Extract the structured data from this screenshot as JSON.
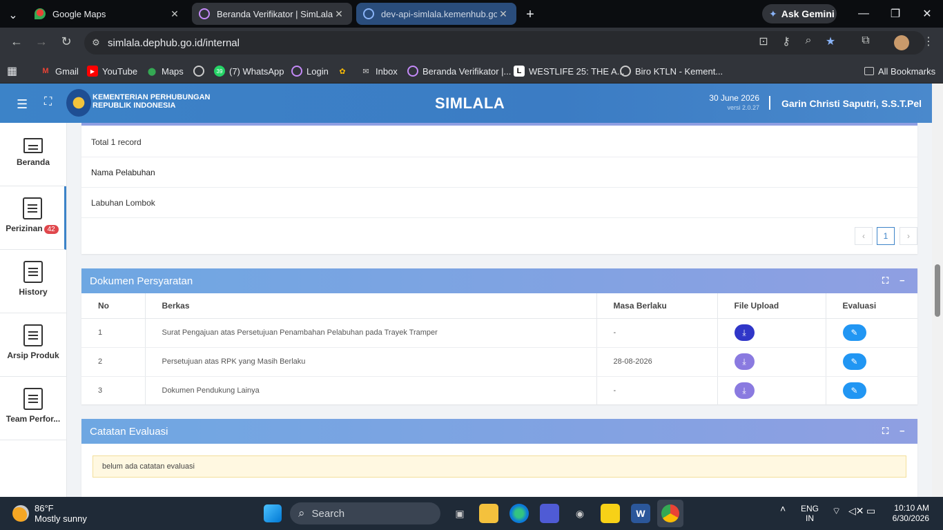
{
  "browser": {
    "tabs": [
      {
        "title": "Google Maps",
        "icon": "google-maps-icon"
      },
      {
        "title": "Beranda Verifikator | SimLala",
        "icon": "simlala-icon",
        "active": true
      },
      {
        "title": "dev-api-simlala.kemenhub.go.id",
        "icon": "globe-icon"
      }
    ],
    "gemini": "Ask Gemini",
    "url": "simlala.dephub.go.id/internal",
    "bookmarks": [
      "Gmail",
      "YouTube",
      "Maps",
      "(7) WhatsApp",
      "Login",
      "Inbox",
      "Beranda Verifikator |...",
      "WESTLIFE 25: THE A...",
      "Biro KTLN - Kement..."
    ],
    "whatsapp_count": "39",
    "all_bookmarks": "All Bookmarks"
  },
  "app": {
    "ministry_line1": "KEMENTERIAN PERHUBUNGAN",
    "ministry_line2": "REPUBLIK INDONESIA",
    "name": "SIMLALA",
    "date": "30 June 2026",
    "version": "versi 2.0.27",
    "user": "Garin Christi Saputri, S.S.T.Pel"
  },
  "sidebar": [
    {
      "label": "Beranda"
    },
    {
      "label": "Perizinan",
      "badge": "42"
    },
    {
      "label": "History"
    },
    {
      "label": "Arsip Produk"
    },
    {
      "label": "Team Perfor..."
    }
  ],
  "port_table": {
    "total": "Total 1 record",
    "header": "Nama Pelabuhan",
    "rows": [
      "Labuhan Lombok"
    ],
    "page": "1",
    "prev": "‹",
    "next": "›"
  },
  "dokumen": {
    "title": "Dokumen Persyaratan",
    "columns": [
      "No",
      "Berkas",
      "Masa Berlaku",
      "File Upload",
      "Evaluasi"
    ],
    "rows": [
      {
        "no": "1",
        "berkas": "Surat Pengajuan atas Persetujuan Penambahan Pelabuhan pada Trayek Tramper",
        "masa": "-"
      },
      {
        "no": "2",
        "berkas": "Persetujuan atas RPK yang Masih Berlaku",
        "masa": "28-08-2026"
      },
      {
        "no": "3",
        "berkas": "Dokumen Pendukung Lainya",
        "masa": "-"
      }
    ]
  },
  "catatan": {
    "title": "Catatan Evaluasi",
    "empty": "belum ada catatan evaluasi"
  },
  "taskbar": {
    "temp": "86°F",
    "weather": "Mostly sunny",
    "search": "Search",
    "lang1": "ENG",
    "lang2": "IN",
    "time": "10:10 AM",
    "date": "6/30/2026"
  }
}
